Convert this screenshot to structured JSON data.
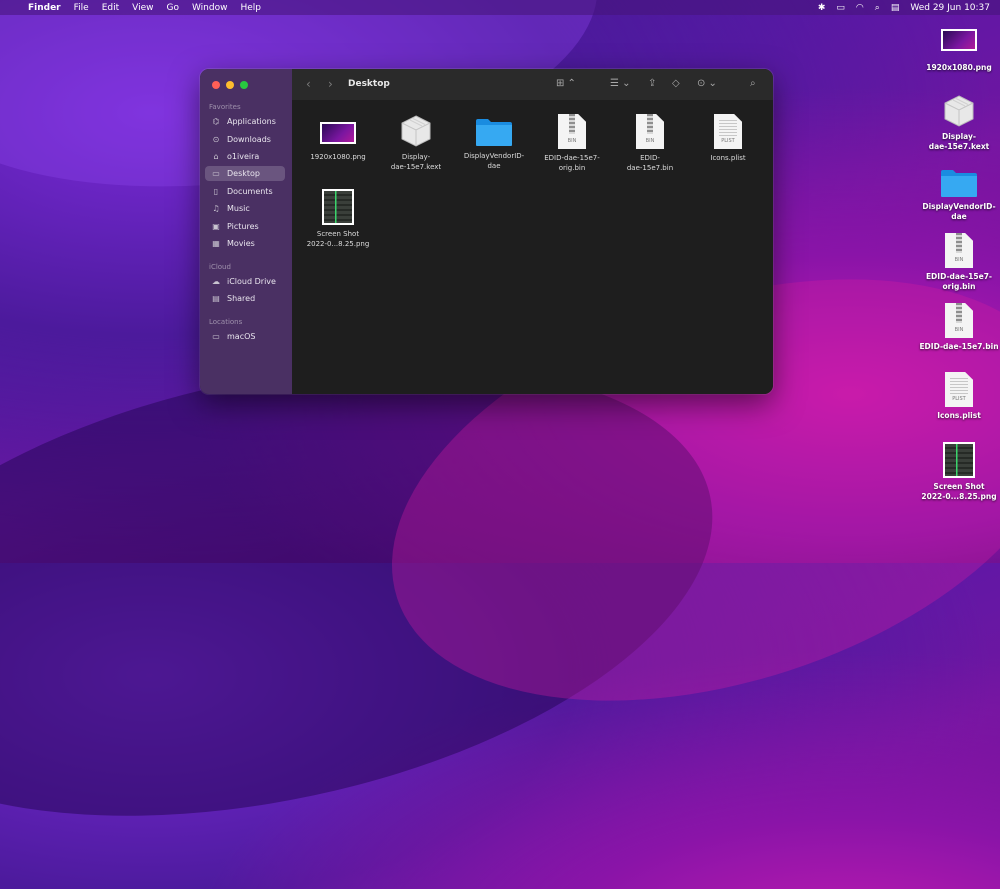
{
  "menubar": {
    "app": "Finder",
    "items": [
      "File",
      "Edit",
      "View",
      "Go",
      "Window",
      "Help"
    ],
    "datetime": "Wed 29 Jun  10:37"
  },
  "window": {
    "title": "Desktop",
    "sidebar": {
      "favorites_label": "Favorites",
      "favorites": [
        "Applications",
        "Downloads",
        "o1iveira",
        "Desktop",
        "Documents",
        "Music",
        "Pictures",
        "Movies"
      ],
      "icloud_label": "iCloud",
      "icloud": [
        "iCloud Drive",
        "Shared"
      ],
      "locations_label": "Locations",
      "locations": [
        "macOS"
      ]
    },
    "files": [
      {
        "line1": "1920x1080.png",
        "line2": ""
      },
      {
        "line1": "Display-",
        "line2": "dae-15e7.kext"
      },
      {
        "line1": "DisplayVendorID-",
        "line2": "dae"
      },
      {
        "line1": "EDID-dae-15e7-",
        "line2": "orig.bin"
      },
      {
        "line1": "EDID-",
        "line2": "dae-15e7.bin"
      },
      {
        "line1": "Icons.plist",
        "line2": ""
      },
      {
        "line1": "Screen Shot",
        "line2": "2022-0...8.25.png"
      }
    ],
    "tags": {
      "bin": "BIN",
      "plist": "PLIST"
    }
  },
  "desktop": [
    {
      "line1": "1920x1080.png",
      "line2": ""
    },
    {
      "line1": "Display-",
      "line2": "dae-15e7.kext"
    },
    {
      "line1": "DisplayVendorID-",
      "line2": "dae"
    },
    {
      "line1": "EDID-dae-15e7-",
      "line2": "orig.bin"
    },
    {
      "line1": "EDID-dae-15e7.bin",
      "line2": ""
    },
    {
      "line1": "Icons.plist",
      "line2": ""
    },
    {
      "line1": "Screen Shot",
      "line2": "2022-0...8.25.png"
    }
  ]
}
